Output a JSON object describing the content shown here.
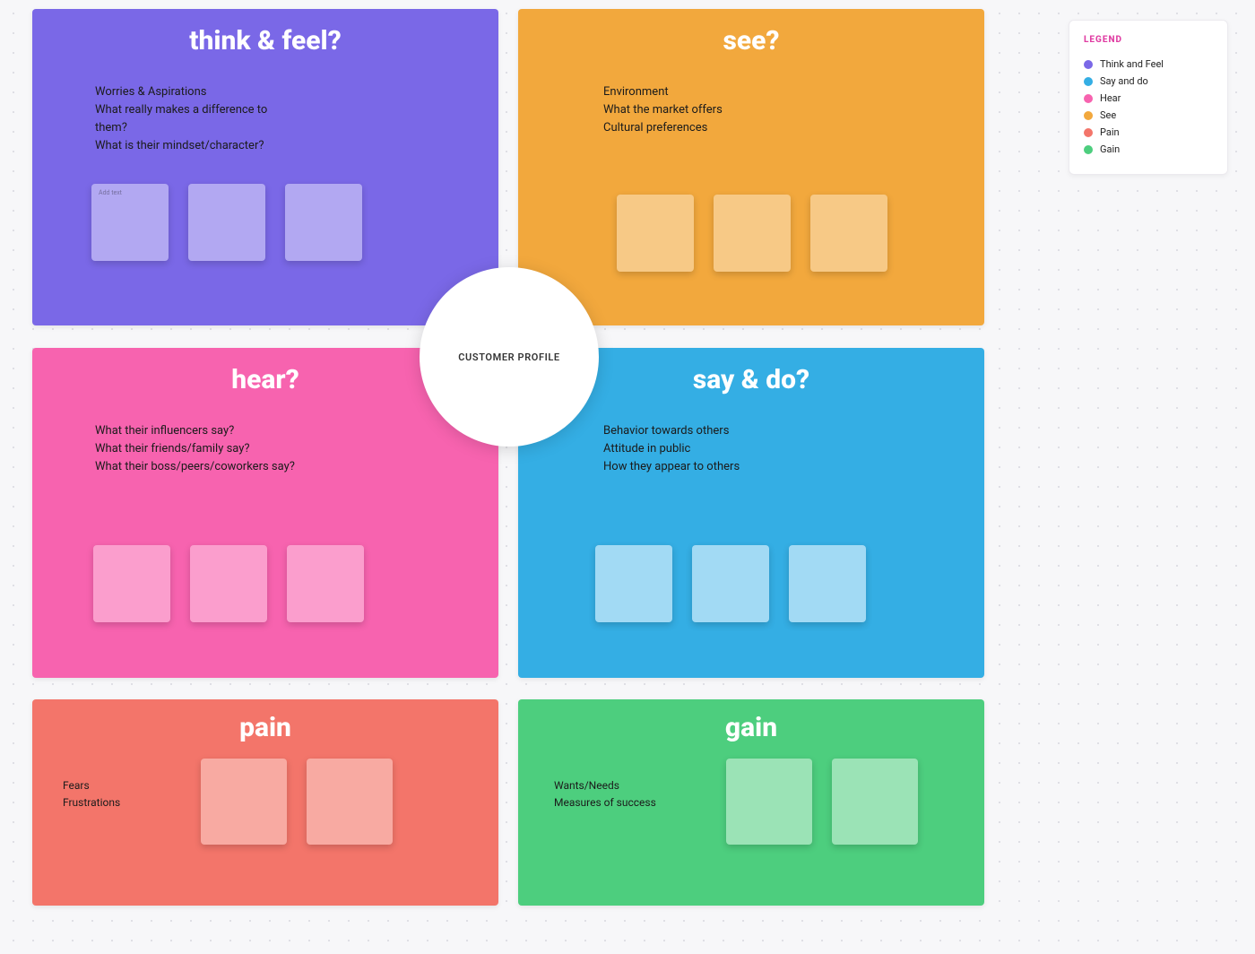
{
  "center": {
    "label": "CUSTOMER PROFILE"
  },
  "think": {
    "title": "think & feel?",
    "prompts": [
      "Worries & Aspirations",
      "What really makes a difference to them?",
      "What is their mindset/character?"
    ],
    "card_hint": "Add text"
  },
  "see": {
    "title": "see?",
    "prompts": [
      "Environment",
      "What the market offers",
      "Cultural preferences"
    ]
  },
  "hear": {
    "title": "hear?",
    "prompts": [
      "What their influencers say?",
      "What their friends/family say?",
      "What their boss/peers/coworkers say?"
    ]
  },
  "say": {
    "title": "say & do?",
    "prompts": [
      "Behavior towards others",
      "Attitude in public",
      "How they appear to others"
    ]
  },
  "pain": {
    "title": "pain",
    "prompts": [
      "Fears",
      "Frustrations"
    ]
  },
  "gain": {
    "title": "gain",
    "prompts": [
      "Wants/Needs",
      "Measures of success"
    ]
  },
  "legend": {
    "title": "LEGEND",
    "items": [
      {
        "label": "Think and Feel",
        "color": "#7a68e7"
      },
      {
        "label": "Say and do",
        "color": "#34aee4"
      },
      {
        "label": "Hear",
        "color": "#f763af"
      },
      {
        "label": "See",
        "color": "#f2a83d"
      },
      {
        "label": "Pain",
        "color": "#f3756a"
      },
      {
        "label": "Gain",
        "color": "#4dce7e"
      }
    ]
  }
}
